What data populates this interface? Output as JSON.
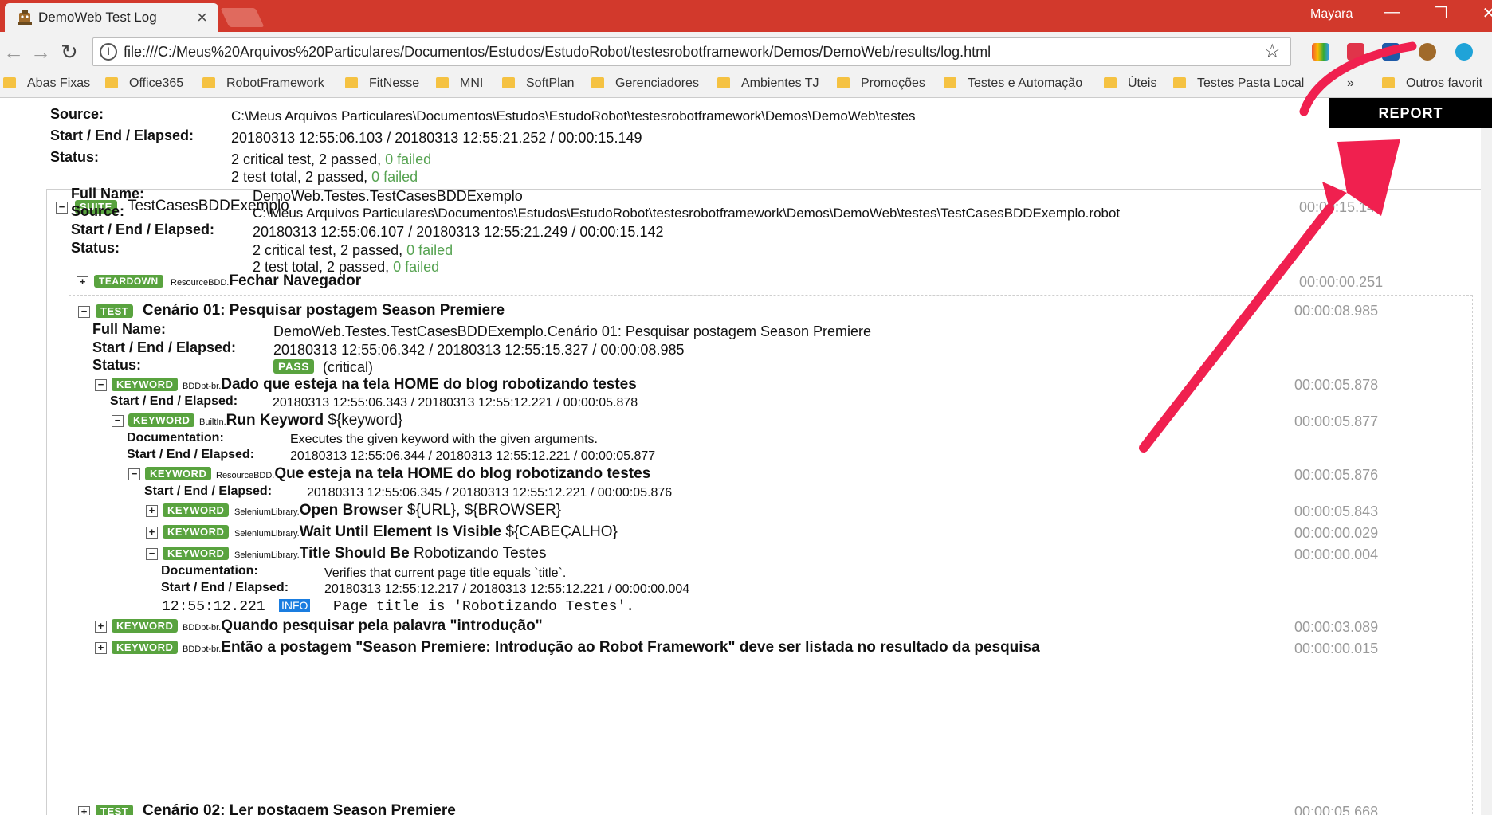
{
  "window": {
    "tab_title": "DemoWeb Test Log",
    "tab_close": "×",
    "user": "Mayara",
    "minimize": "—",
    "restore": "❐",
    "close": "✕"
  },
  "toolbar": {
    "url": "file:///C:/Meus%20Arquivos%20Particulares/Documentos/Estudos/EstudoRobot/testesrobotframework/Demos/DemoWeb/results/log.html",
    "back": "←",
    "forward": "→",
    "reload": "↻",
    "info": "i",
    "star": "☆"
  },
  "bookmarks": {
    "items": [
      "Abas Fixas",
      "Office365",
      "RobotFramework",
      "FitNesse",
      "MNI",
      "SoftPlan",
      "Gerenciadores",
      "Ambientes TJ",
      "Promoções",
      "Testes e Automação",
      "Úteis",
      "Testes Pasta Local"
    ],
    "overflow": "»",
    "other": "Outros favorit"
  },
  "report_button": "REPORT",
  "top_suite": {
    "source_label": "Source:",
    "source": "C:\\Meus Arquivos Particulares\\Documentos\\Estudos\\EstudoRobot\\testesrobotframework\\Demos\\DemoWeb\\testes",
    "elapsed_label": "Start / End / Elapsed:",
    "elapsed": "20180313 12:55:06.103 / 20180313 12:55:21.252 / 00:00:15.149",
    "status_label": "Status:",
    "status_critical": "2 critical test, 2 passed,",
    "status_critical_failed": "0 failed",
    "status_total": "2 test total, 2 passed,",
    "status_total_failed": "0 failed"
  },
  "suite": {
    "badge": "SUITE",
    "name": "TestCasesBDDExemplo",
    "time": "00:00:15.142",
    "fullname_label": "Full Name:",
    "fullname": "DemoWeb.Testes.TestCasesBDDExemplo",
    "source_label": "Source:",
    "source": "C:\\Meus Arquivos Particulares\\Documentos\\Estudos\\EstudoRobot\\testesrobotframework\\Demos\\DemoWeb\\testes\\TestCasesBDDExemplo.robot",
    "elapsed_label": "Start / End / Elapsed:",
    "elapsed": "20180313 12:55:06.107 / 20180313 12:55:21.249 / 00:00:15.142",
    "status_label": "Status:",
    "status_critical": "2 critical test, 2 passed,",
    "status_critical_failed": "0 failed",
    "status_total": "2 test total, 2 passed,",
    "status_total_failed": "0 failed"
  },
  "teardown": {
    "badge": "TEARDOWN",
    "lib": "ResourceBDD.",
    "name": "Fechar Navegador",
    "time": "00:00:00.251"
  },
  "test1": {
    "badge": "TEST",
    "name": "Cenário 01: Pesquisar postagem Season Premiere",
    "time": "00:00:08.985",
    "fullname_label": "Full Name:",
    "fullname": "DemoWeb.Testes.TestCasesBDDExemplo.Cenário 01: Pesquisar postagem Season Premiere",
    "elapsed_label": "Start / End / Elapsed:",
    "elapsed": "20180313 12:55:06.342 / 20180313 12:55:15.327 / 00:00:08.985",
    "status_label": "Status:",
    "status_badge": "PASS",
    "status_text": "(critical)"
  },
  "kw1": {
    "badge": "KEYWORD",
    "lib": "BDDpt-br.",
    "name": "Dado que esteja na tela HOME do blog robotizando testes",
    "time": "00:00:05.878",
    "elapsed_label": "Start / End / Elapsed:",
    "elapsed": "20180313 12:55:06.343 / 20180313 12:55:12.221 / 00:00:05.878"
  },
  "kw2": {
    "badge": "KEYWORD",
    "lib": "BuiltIn.",
    "name": "Run Keyword",
    "args": "${keyword}",
    "time": "00:00:05.877",
    "doc_label": "Documentation:",
    "doc": "Executes the given keyword with the given arguments.",
    "elapsed_label": "Start / End / Elapsed:",
    "elapsed": "20180313 12:55:06.344 / 20180313 12:55:12.221 / 00:00:05.877"
  },
  "kw3": {
    "badge": "KEYWORD",
    "lib": "ResourceBDD.",
    "name": "Que esteja na tela HOME do blog robotizando testes",
    "time": "00:00:05.876",
    "elapsed_label": "Start / End / Elapsed:",
    "elapsed": "20180313 12:55:06.345 / 20180313 12:55:12.221 / 00:00:05.876"
  },
  "kw4": {
    "badge": "KEYWORD",
    "lib": "SeleniumLibrary.",
    "name": "Open Browser",
    "args": "${URL}, ${BROWSER}",
    "time": "00:00:05.843"
  },
  "kw5": {
    "badge": "KEYWORD",
    "lib": "SeleniumLibrary.",
    "name": "Wait Until Element Is Visible",
    "args": "${CABEÇALHO}",
    "time": "00:00:00.029"
  },
  "kw6": {
    "badge": "KEYWORD",
    "lib": "SeleniumLibrary.",
    "name": "Title Should Be",
    "args": "Robotizando Testes",
    "time": "00:00:00.004",
    "doc_label": "Documentation:",
    "doc": "Verifies that current page title equals `title`.",
    "elapsed_label": "Start / End / Elapsed:",
    "elapsed": "20180313 12:55:12.217 / 20180313 12:55:12.221 / 00:00:00.004",
    "msg_time": "12:55:12.221",
    "msg_level": "INFO",
    "msg_text": "Page title is 'Robotizando Testes'."
  },
  "kw7": {
    "badge": "KEYWORD",
    "lib": "BDDpt-br.",
    "name": "Quando pesquisar pela palavra \"introdução\"",
    "time": "00:00:03.089"
  },
  "kw8": {
    "badge": "KEYWORD",
    "lib": "BDDpt-br.",
    "name": "Então a postagem \"Season Premiere: Introdução ao Robot Framework\" deve ser listada no resultado da pesquisa",
    "time": "00:00:00.015"
  },
  "test2": {
    "badge": "TEST",
    "name": "Cenário 02: Ler postagem Season Premiere",
    "time": "00:00:05.668"
  },
  "colors": {
    "titlebar": "#d2392c",
    "badge_green": "#59a33f",
    "link_blue": "#1e5aa8",
    "arrow_red": "#f0204f"
  }
}
